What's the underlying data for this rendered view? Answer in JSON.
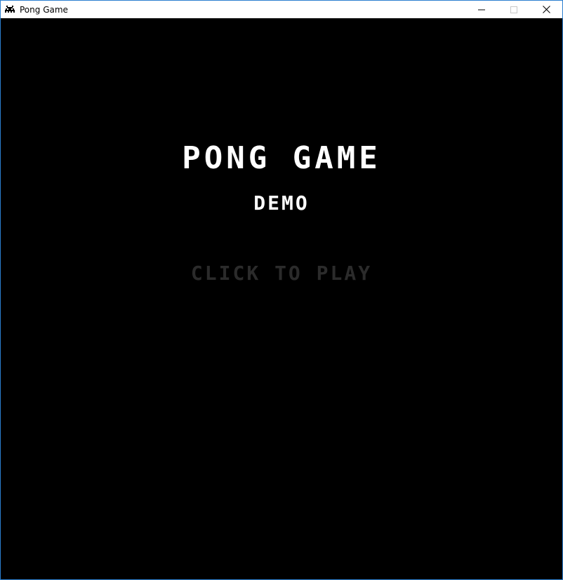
{
  "window": {
    "title": "Pong Game",
    "app_icon": "space-invader-icon",
    "controls": [
      "minimize-icon",
      "maximize-icon",
      "close-icon"
    ]
  },
  "game": {
    "title": "PONG GAME",
    "subtitle": "DEMO",
    "prompt": "CLICK TO PLAY",
    "colors": {
      "background": "#000000",
      "title": "#ffffff",
      "prompt": "#2b2b2b"
    }
  }
}
